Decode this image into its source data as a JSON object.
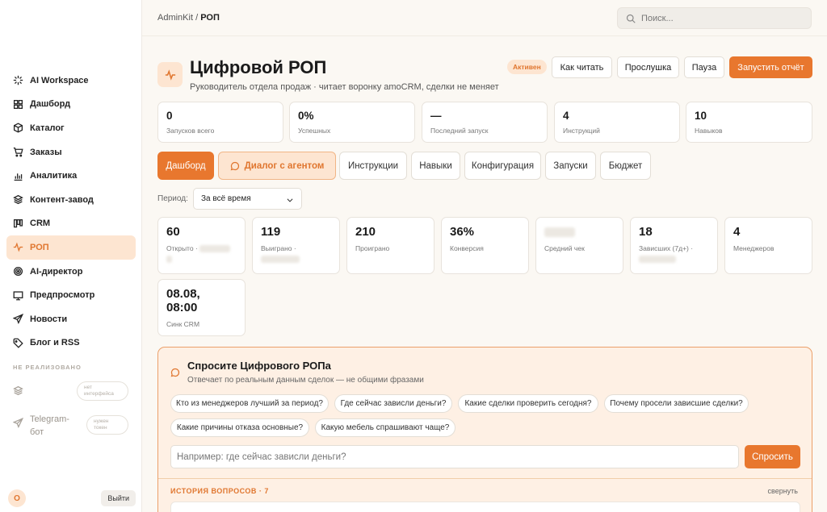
{
  "breadcrumb": {
    "root": "AdminKit",
    "separator": "/",
    "current": "РОП"
  },
  "search": {
    "placeholder": "Поиск..."
  },
  "sidebar": {
    "items": [
      {
        "label": "AI Workspace",
        "icon": "sparkle-icon"
      },
      {
        "label": "Дашборд",
        "icon": "grid-icon"
      },
      {
        "label": "Каталог",
        "icon": "box-icon"
      },
      {
        "label": "Заказы",
        "icon": "cart-icon"
      },
      {
        "label": "Аналитика",
        "icon": "bar-chart-icon"
      },
      {
        "label": "Контент-завод",
        "icon": "layers-icon"
      },
      {
        "label": "CRM",
        "icon": "kanban-icon"
      },
      {
        "label": "РОП",
        "icon": "pulse-icon",
        "active": true
      },
      {
        "label": "AI-директор",
        "icon": "target-icon"
      },
      {
        "label": "Предпросмотр",
        "icon": "monitor-icon"
      },
      {
        "label": "Новости",
        "icon": "send-icon"
      },
      {
        "label": "Блог и RSS",
        "icon": "tag-icon"
      }
    ],
    "not_implemented_title": "НЕ РЕАЛИЗОВАНО",
    "not_implemented": [
      {
        "label": "",
        "note": "нет интерфейса",
        "icon": "layers-icon"
      },
      {
        "label": "Telegram-бот",
        "note": "нужен токен",
        "icon": "send-icon"
      }
    ],
    "user_initial": "O",
    "logout": "Выйти"
  },
  "header": {
    "title": "Цифровой РОП",
    "subtitle": "Руководитель отдела продаж · читает воронку amoCRM, сделки не меняет",
    "status_badge": "Активен",
    "actions": {
      "how_to_read": "Как читать",
      "listen": "Прослушка",
      "pause": "Пауза",
      "run_report": "Запустить отчёт"
    }
  },
  "stats": [
    {
      "value": "0",
      "label": "Запусков всего"
    },
    {
      "value": "0%",
      "label": "Успешных"
    },
    {
      "value": "—",
      "label": "Последний запуск"
    },
    {
      "value": "4",
      "label": "Инструкций"
    },
    {
      "value": "10",
      "label": "Навыков"
    }
  ],
  "tabs": {
    "dashboard": "Дашборд",
    "agent": "Диалог с агентом",
    "instructions": "Инструкции",
    "skills": "Навыки",
    "config": "Конфигурация",
    "runs": "Запуски",
    "budget": "Бюджет"
  },
  "period": {
    "label": "Период:",
    "value": "За всё время"
  },
  "metrics": [
    {
      "value": "60",
      "label": "Открыто ·"
    },
    {
      "value": "119",
      "label": "Выиграно ·"
    },
    {
      "value": "210",
      "label": "Проиграно"
    },
    {
      "value": "36%",
      "label": "Конверсия"
    },
    {
      "value": "",
      "label": "Средний чек"
    },
    {
      "value": "18",
      "label": "Зависших (7д+) ·"
    },
    {
      "value": "4",
      "label": "Менеджеров"
    },
    {
      "value": "08.08, 08:00",
      "label": "Синк CRM"
    }
  ],
  "ask": {
    "title": "Спросите Цифрового РОПа",
    "subtitle": "Отвечает по реальным данным сделок — не общими фразами",
    "chips": [
      "Кто из менеджеров лучший за период?",
      "Где сейчас зависли деньги?",
      "Какие сделки проверить сегодня?",
      "Почему просели зависшие сделки?",
      "Какие причины отказа основные?",
      "Какую мебель спрашивают чаще?"
    ],
    "input_placeholder": "Например: где сейчас зависли деньги?",
    "submit": "Спросить",
    "history": "ИСТОРИЯ ВОПРОСОВ · 7",
    "collapse": "свернуть"
  },
  "colors": {
    "accent": "#e8772e",
    "accent_light": "#fde5d1",
    "background": "#fbf8f3"
  }
}
